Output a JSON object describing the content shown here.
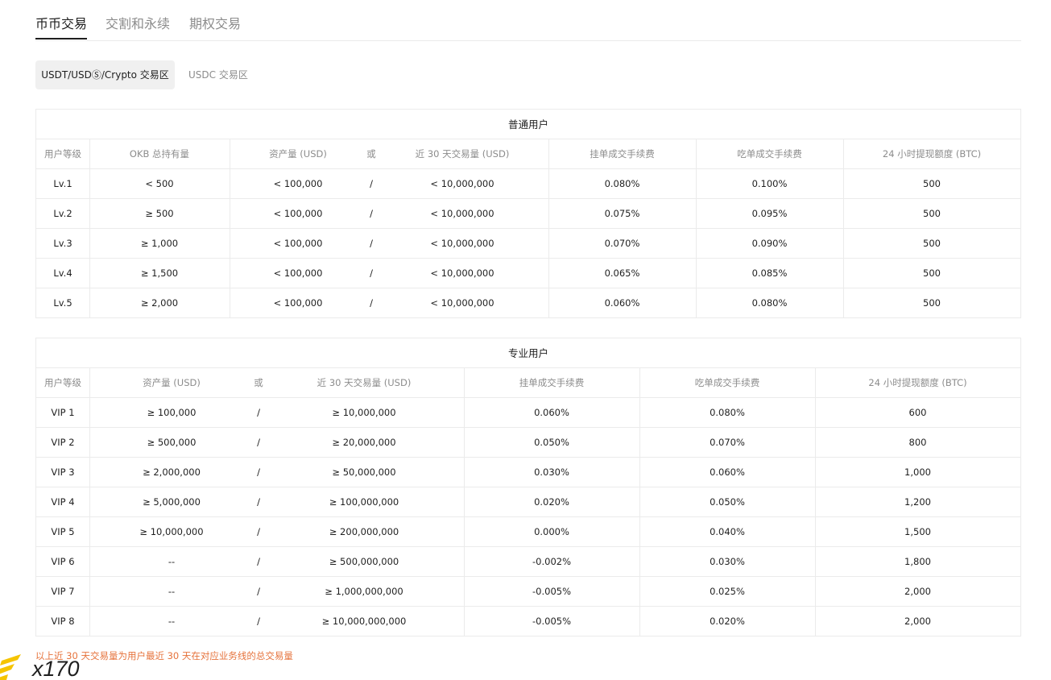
{
  "tabs": [
    "币币交易",
    "交割和永续",
    "期权交易"
  ],
  "subtabs": [
    "USDT/USDⓈ/Crypto 交易区",
    "USDC 交易区"
  ],
  "regular": {
    "title": "普通用户",
    "headers": {
      "level": "用户等级",
      "okb": "OKB 总持有量",
      "assets": "资产量 (USD)",
      "or": "或",
      "volume": "近 30 天交易量 (USD)",
      "maker": "挂单成交手续费",
      "taker": "吃单成交手续费",
      "withdraw": "24 小时提现额度 (BTC)"
    },
    "rows": [
      {
        "level": "Lv.1",
        "okb": "< 500",
        "assets": "< 100,000",
        "sep": "/",
        "volume": "< 10,000,000",
        "maker": "0.080%",
        "taker": "0.100%",
        "withdraw": "500"
      },
      {
        "level": "Lv.2",
        "okb": "≥ 500",
        "assets": "< 100,000",
        "sep": "/",
        "volume": "< 10,000,000",
        "maker": "0.075%",
        "taker": "0.095%",
        "withdraw": "500"
      },
      {
        "level": "Lv.3",
        "okb": "≥ 1,000",
        "assets": "< 100,000",
        "sep": "/",
        "volume": "< 10,000,000",
        "maker": "0.070%",
        "taker": "0.090%",
        "withdraw": "500"
      },
      {
        "level": "Lv.4",
        "okb": "≥ 1,500",
        "assets": "< 100,000",
        "sep": "/",
        "volume": "< 10,000,000",
        "maker": "0.065%",
        "taker": "0.085%",
        "withdraw": "500"
      },
      {
        "level": "Lv.5",
        "okb": "≥ 2,000",
        "assets": "< 100,000",
        "sep": "/",
        "volume": "< 10,000,000",
        "maker": "0.060%",
        "taker": "0.080%",
        "withdraw": "500"
      }
    ]
  },
  "pro": {
    "title": "专业用户",
    "headers": {
      "level": "用户等级",
      "assets": "资产量 (USD)",
      "or": "或",
      "volume": "近 30 天交易量 (USD)",
      "maker": "挂单成交手续费",
      "taker": "吃单成交手续费",
      "withdraw": "24 小时提现额度 (BTC)"
    },
    "rows": [
      {
        "level": "VIP 1",
        "assets": "≥ 100,000",
        "sep": "/",
        "volume": "≥ 10,000,000",
        "maker": "0.060%",
        "taker": "0.080%",
        "withdraw": "600"
      },
      {
        "level": "VIP 2",
        "assets": "≥ 500,000",
        "sep": "/",
        "volume": "≥ 20,000,000",
        "maker": "0.050%",
        "taker": "0.070%",
        "withdraw": "800"
      },
      {
        "level": "VIP 3",
        "assets": "≥ 2,000,000",
        "sep": "/",
        "volume": "≥ 50,000,000",
        "maker": "0.030%",
        "taker": "0.060%",
        "withdraw": "1,000"
      },
      {
        "level": "VIP 4",
        "assets": "≥ 5,000,000",
        "sep": "/",
        "volume": "≥ 100,000,000",
        "maker": "0.020%",
        "taker": "0.050%",
        "withdraw": "1,200"
      },
      {
        "level": "VIP 5",
        "assets": "≥ 10,000,000",
        "sep": "/",
        "volume": "≥ 200,000,000",
        "maker": "0.000%",
        "taker": "0.040%",
        "withdraw": "1,500"
      },
      {
        "level": "VIP 6",
        "assets": "--",
        "sep": "/",
        "volume": "≥ 500,000,000",
        "maker": "-0.002%",
        "taker": "0.030%",
        "withdraw": "1,800"
      },
      {
        "level": "VIP 7",
        "assets": "--",
        "sep": "/",
        "volume": "≥ 1,000,000,000",
        "maker": "-0.005%",
        "taker": "0.025%",
        "withdraw": "2,000"
      },
      {
        "level": "VIP 8",
        "assets": "--",
        "sep": "/",
        "volume": "≥ 10,000,000,000",
        "maker": "-0.005%",
        "taker": "0.020%",
        "withdraw": "2,000"
      }
    ]
  },
  "note": "以上近 30 天交易量为用户最近 30 天在对应业务线的总交易量",
  "logo_text": "x170",
  "colors": {
    "accent_note": "#e6733c",
    "logo_yellow": "#f5c400",
    "border": "#ebebeb",
    "muted_text": "#8c8c8c"
  }
}
